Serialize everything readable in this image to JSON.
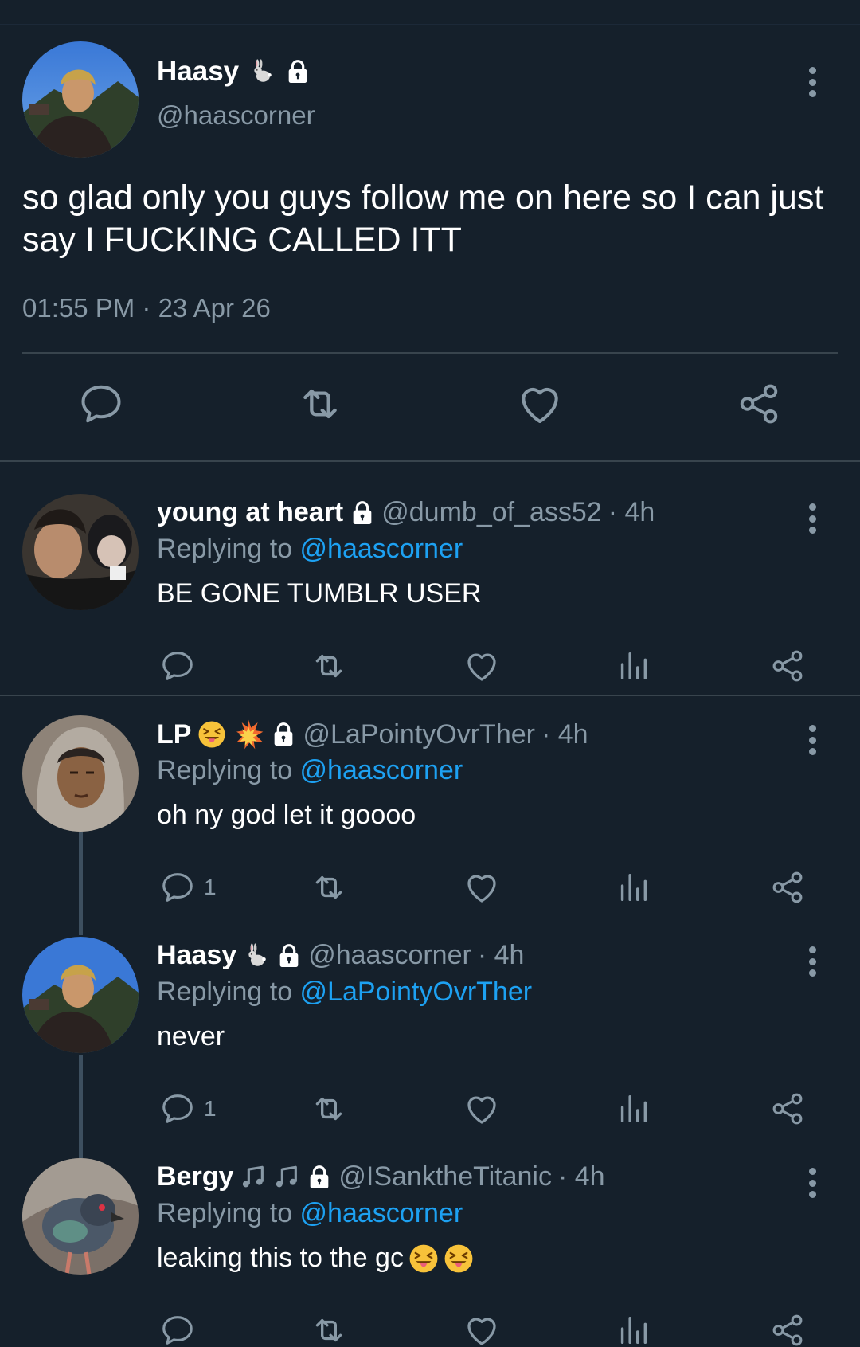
{
  "main": {
    "name": "Haasy",
    "handle": "@haascorner",
    "text": "so glad only you guys follow me on here so I can just say I FUCKING CALLED ITT",
    "timestamp": "01:55 PM · 23 Apr 26"
  },
  "replies": [
    {
      "name": "young at heart",
      "handle": "@dumb_of_ass52",
      "time": "· 4h",
      "replying_prefix": "Replying to ",
      "replying_to": "@haascorner",
      "text": "BE GONE TUMBLR USER",
      "reply_count": ""
    },
    {
      "name": "LP",
      "handle": "@LaPointyOvrTher",
      "time": "· 4h",
      "replying_prefix": "Replying to ",
      "replying_to": "@haascorner",
      "text": "oh ny god let it goooo",
      "reply_count": "1"
    },
    {
      "name": "Haasy",
      "handle": "@haascorner",
      "time": "· 4h",
      "replying_prefix": "Replying to ",
      "replying_to": "@LaPointyOvrTher",
      "text": "never",
      "reply_count": "1"
    },
    {
      "name": "Bergy",
      "handle": "@ISanktheTitanic",
      "time": "· 4h",
      "replying_prefix": "Replying to ",
      "replying_to": "@haascorner",
      "text": "leaking this to the gc",
      "reply_count": ""
    }
  ],
  "icons": [
    "rabbit-icon",
    "lock-icon",
    "more-vertical-icon",
    "reply-icon",
    "retweet-icon",
    "like-icon",
    "analytics-icon",
    "share-icon",
    "squinting-tongue-emoji",
    "collision-emoji",
    "musical-note-icon"
  ],
  "colors": {
    "background": "#15202b",
    "secondary_text": "#8899a6",
    "link": "#1da1f2",
    "divider": "#38444d"
  }
}
